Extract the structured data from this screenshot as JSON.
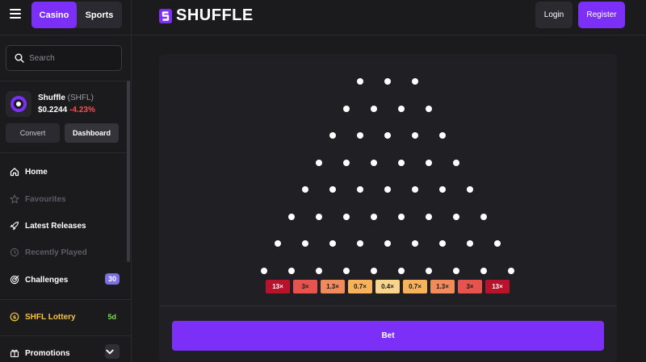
{
  "sidebar": {
    "tabs": [
      {
        "label": "Casino"
      },
      {
        "label": "Sports"
      }
    ],
    "search_placeholder": "Search",
    "token": {
      "name": "Shuffle",
      "symbol": "(SHFL)",
      "price": "$0.2244",
      "change": "-4.23%"
    },
    "convert_label": "Convert",
    "dashboard_label": "Dashboard",
    "nav": [
      {
        "label": "Home",
        "icon": "home-icon"
      },
      {
        "label": "Favourites",
        "icon": "star-icon"
      },
      {
        "label": "Latest Releases",
        "icon": "rocket-icon"
      },
      {
        "label": "Recently Played",
        "icon": "history-icon"
      },
      {
        "label": "Challenges",
        "icon": "target-icon",
        "badge": "30"
      },
      {
        "label": "SHFL Lottery",
        "icon": "coin-icon",
        "badge": "5d"
      },
      {
        "label": "Promotions",
        "icon": "gift-icon"
      }
    ]
  },
  "header": {
    "logo_text": "SHUFFLE",
    "login_label": "Login",
    "register_label": "Register"
  },
  "game": {
    "multipliers": [
      {
        "label": "13×",
        "color": "#b8132b"
      },
      {
        "label": "3×",
        "color": "#e8534d"
      },
      {
        "label": "1.3×",
        "color": "#f28b5c"
      },
      {
        "label": "0.7×",
        "color": "#f7b25a"
      },
      {
        "label": "0.4×",
        "color": "#f9d48a"
      },
      {
        "label": "0.7×",
        "color": "#f7b25a"
      },
      {
        "label": "1.3×",
        "color": "#f28b5c"
      },
      {
        "label": "3×",
        "color": "#e8534d"
      },
      {
        "label": "13×",
        "color": "#b8132b"
      }
    ],
    "bet_label": "Bet"
  },
  "colors": {
    "accent": "#7b2ff7",
    "badge": "#7b6ee6",
    "lottery": "#f5c543",
    "negative": "#ff4d4d"
  }
}
